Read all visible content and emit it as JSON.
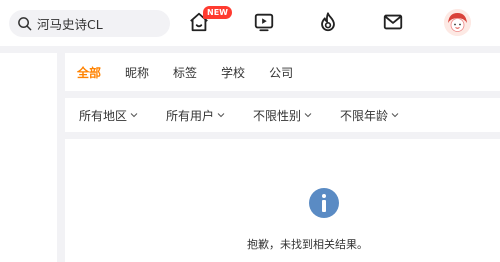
{
  "search": {
    "query": "河马史诗CL"
  },
  "nav": {
    "home_badge": "NEW",
    "icons": [
      "home-icon",
      "video-icon",
      "hot-icon",
      "message-icon"
    ]
  },
  "tabs": [
    {
      "label": "全部",
      "active": true
    },
    {
      "label": "昵称",
      "active": false
    },
    {
      "label": "标签",
      "active": false
    },
    {
      "label": "学校",
      "active": false
    },
    {
      "label": "公司",
      "active": false
    }
  ],
  "filters": [
    {
      "label": "所有地区"
    },
    {
      "label": "所有用户"
    },
    {
      "label": "不限性别"
    },
    {
      "label": "不限年龄"
    }
  ],
  "empty_state": {
    "message": "抱歉，未找到相关结果。"
  },
  "colors": {
    "accent": "#ff8200",
    "badge": "#ff3b30",
    "info": "#5a8bc4"
  }
}
